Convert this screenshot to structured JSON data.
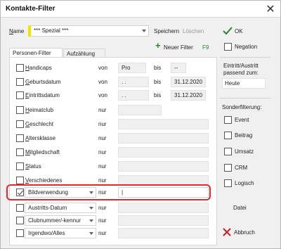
{
  "window": {
    "title": "Kontakte-Filter",
    "close_glyph": "✕"
  },
  "name_field": {
    "label": "Name",
    "value": "*** Spezial ***"
  },
  "top_buttons": {
    "save": "Speichern",
    "delete": "Löschen",
    "new_filter": "Neuer Filter",
    "new_filter_key": "F9",
    "plus": "+"
  },
  "tabs": {
    "personen_filter": "Personen-Filter",
    "aufzaehlung": "Aufzählung"
  },
  "filters": [
    {
      "label": "Handicaps",
      "op": "von",
      "from": "Pro",
      "to_label": "bis",
      "to": "--",
      "checked": false
    },
    {
      "label": "Geburtsdatum",
      "op": "von",
      "from": ". .",
      "to_label": "bis",
      "to": "31.12.2020",
      "checked": false
    },
    {
      "label": "Eintrittsdatum",
      "op": "von",
      "from": ". .",
      "to_label": "bis",
      "to": "31.12.2020",
      "checked": false
    },
    {
      "label": "Heimatclub",
      "op": "nur",
      "checked": false
    },
    {
      "label": "Geschlecht",
      "op": "nur",
      "checked": false
    },
    {
      "label": "Altersklasse",
      "op": "nur",
      "checked": false
    },
    {
      "label": "Mitgliedschaft",
      "op": "nur",
      "checked": false
    },
    {
      "label": "Status",
      "op": "nur",
      "checked": false
    },
    {
      "label": "Verschiedenes",
      "op": "nur",
      "checked": false
    }
  ],
  "dropdown_filters": [
    {
      "label": "Bildverwendung",
      "op": "nur",
      "value": "|",
      "checked": true
    },
    {
      "label": "Austritts-Datum",
      "op": "nur",
      "checked": false
    },
    {
      "label": "Clubnummer/-kennur",
      "op": "nur",
      "checked": false
    },
    {
      "label": "Irgendwo/Alles",
      "op": "nur",
      "checked": false
    }
  ],
  "side": {
    "ok": "OK",
    "negation": "Negation",
    "eintritt_label": "Eintritt/Austritt passend zum:",
    "eintritt_value": "Heute",
    "sonder_label": "Sonderfilterung:",
    "sonder_items": [
      "Event",
      "Beitrag",
      "Umsatz",
      "CRM",
      "Logisch"
    ],
    "datei": "Datei",
    "abbruch": "Abbruch"
  },
  "colors": {
    "highlight": "#e8262c",
    "name_marker": "#f0e400",
    "ok_check": "#1f8c2c",
    "abbruch_x": "#cc2020",
    "plus": "#228822"
  }
}
